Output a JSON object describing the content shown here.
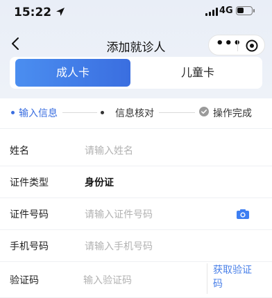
{
  "status_bar": {
    "time": "15:22",
    "network": "4G"
  },
  "nav": {
    "title": "添加就诊人",
    "more_label": "•••"
  },
  "tabs": [
    {
      "label": "成人卡",
      "active": true
    },
    {
      "label": "儿童卡",
      "active": false
    }
  ],
  "steps": [
    {
      "label": "输入信息",
      "state": "current"
    },
    {
      "label": "信息核对",
      "state": "pending"
    },
    {
      "label": "操作完成",
      "state": "done"
    }
  ],
  "form": {
    "name": {
      "label": "姓名",
      "placeholder": "请输入姓名"
    },
    "id_type": {
      "label": "证件类型",
      "value": "身份证"
    },
    "id_number": {
      "label": "证件号码",
      "placeholder": "请输入证件号码"
    },
    "phone": {
      "label": "手机号码",
      "placeholder": "请输入手机号码"
    },
    "code": {
      "label": "验证码",
      "placeholder": "输入验证码",
      "button_line1": "获取验证",
      "button_line2": "码"
    }
  },
  "colors": {
    "accent": "#3a6ee0",
    "link": "#4a80e8",
    "placeholder": "#b2b2b2"
  }
}
